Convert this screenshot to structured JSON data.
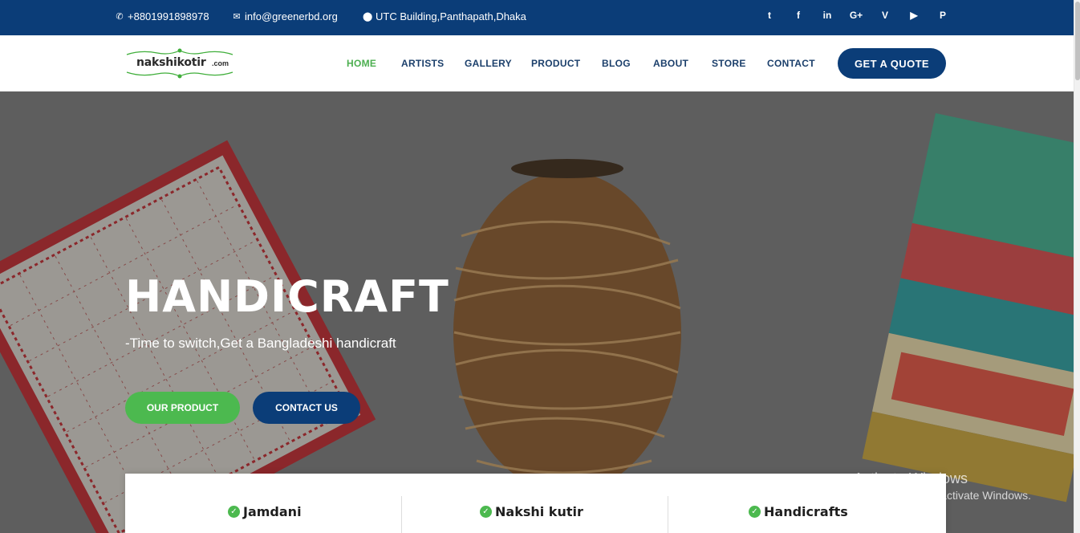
{
  "topbar": {
    "phone": "+8801991898978",
    "email": "info@greenerbd.org",
    "address": "UTC Building,Panthapath,Dhaka",
    "socials": [
      "twitter-icon",
      "facebook-icon",
      "linkedin-icon",
      "googleplus-icon",
      "vimeo-icon",
      "youtube-icon",
      "pinterest-icon"
    ],
    "social_glyphs": [
      "t",
      "f",
      "in",
      "G+",
      "V",
      "▶",
      "P"
    ]
  },
  "nav": {
    "logo_text": "nakshikotir",
    "logo_suffix": ".com",
    "items": [
      "HOME",
      "ARTISTS",
      "GALLERY",
      "PRODUCT",
      "BLOG",
      "ABOUT",
      "STORE",
      "CONTACT"
    ],
    "active_item": "HOME",
    "quote_button": "GET A QUOTE"
  },
  "hero": {
    "title": "HANDICRAFT",
    "subtitle": "-Time to switch,Get a Bangladeshi handicraft",
    "primary_button": "OUR PRODUCT",
    "secondary_button": "CONTACT US"
  },
  "features": [
    {
      "title": "Jamdani"
    },
    {
      "title": "Nakshi kutir"
    },
    {
      "title": "Handicrafts"
    }
  ],
  "watermark": {
    "line1": "Activate Windows",
    "line2": "Go to Settings to activate Windows."
  },
  "colors": {
    "primary": "#0b3d78",
    "accent": "#4cb94f",
    "nav_text": "#1b3f6b"
  }
}
